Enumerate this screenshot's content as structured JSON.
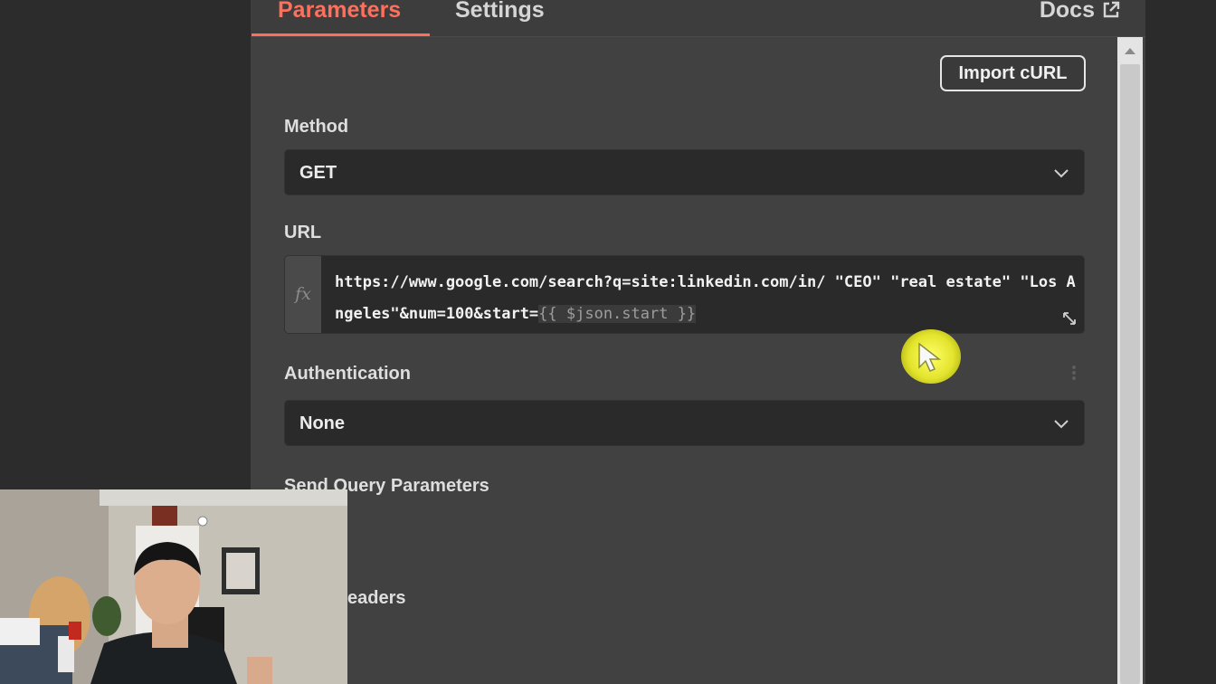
{
  "tabs": [
    {
      "label": "Parameters",
      "active": true
    },
    {
      "label": "Settings",
      "active": false
    }
  ],
  "docs_label": "Docs",
  "import_curl_label": "Import cURL",
  "method": {
    "label": "Method",
    "value": "GET"
  },
  "url": {
    "label": "URL",
    "fx_label": "fx",
    "text": "https://www.google.com/search?q=site:linkedin.com/in/ \"CEO\" \"real estate\" \"Los Angeles\"&num=100&start=",
    "expression": "{{ $json.start }}"
  },
  "authentication": {
    "label": "Authentication",
    "value": "None"
  },
  "send_query_parameters_label": "Send Query Parameters",
  "send_headers_partial_label": "eaders",
  "colors": {
    "accent": "#ff6f5c",
    "panel_bg": "#414141",
    "input_bg": "#2a2a2a",
    "cursor_highlight": "#e3e42c"
  },
  "icons": {
    "docs": "external-link-icon",
    "dropdown": "chevron-down-icon",
    "expand": "expand-icon",
    "options": "kebab-menu-icon",
    "cursor": "mouse-pointer-icon"
  }
}
